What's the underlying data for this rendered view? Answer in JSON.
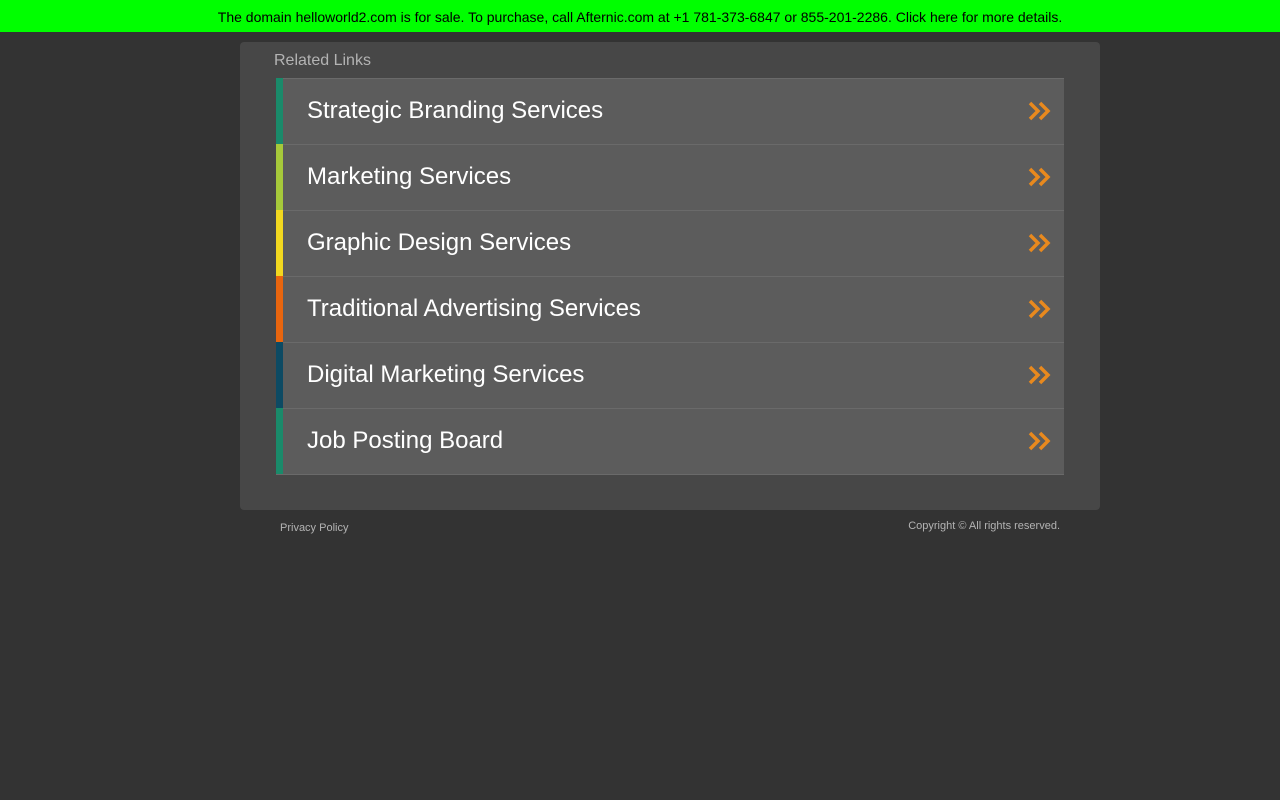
{
  "banner": {
    "text": "The domain helloworld2.com is for sale. To purchase, call Afternic.com at +1 781-373-6847 or 855-201-2286. Click here for more details.",
    "background": "#00ff00"
  },
  "panel": {
    "title": "Related Links"
  },
  "links": [
    {
      "label": "Strategic Branding Services",
      "stripe_color": "#1a8a6a",
      "icon": "double-chevron-right-icon"
    },
    {
      "label": "Marketing Services",
      "stripe_color": "#a6c93a",
      "icon": "double-chevron-right-icon"
    },
    {
      "label": "Graphic Design Services",
      "stripe_color": "#f2d81f",
      "icon": "double-chevron-right-icon"
    },
    {
      "label": "Traditional Advertising Services",
      "stripe_color": "#e8650e",
      "icon": "double-chevron-right-icon"
    },
    {
      "label": "Digital Marketing Services",
      "stripe_color": "#0d4a63",
      "icon": "double-chevron-right-icon"
    },
    {
      "label": "Job Posting Board",
      "stripe_color": "#1a8a6a",
      "icon": "double-chevron-right-icon"
    }
  ],
  "arrow_color": "#e8891e",
  "footer": {
    "privacy": "Privacy Policy",
    "copyright": "Copyright ©  All rights reserved."
  }
}
